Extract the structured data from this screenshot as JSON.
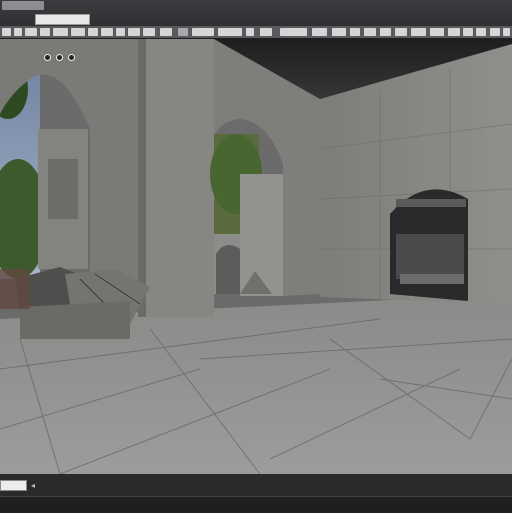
{
  "window": {
    "title": ""
  },
  "toolbar": {
    "search_text": "",
    "buttons": [
      "file",
      "edit",
      "view",
      "build",
      "play",
      "camera",
      "light",
      "material",
      "settings",
      "help",
      "window",
      "tools",
      "layers",
      "snap",
      "grid",
      "scale",
      "rotate",
      "move",
      "select",
      "render",
      "export",
      "import"
    ]
  },
  "viewport": {
    "scene": "stone-courtyard-archways",
    "overlay_icons": [
      "camera-icon",
      "lit-mode-icon",
      "view-options-icon"
    ]
  },
  "statusbar": {
    "chip_text": ""
  },
  "colors": {
    "chrome": "#2e2e30",
    "toolbar": "#5a5a5e",
    "stone": "#8a8a86"
  }
}
